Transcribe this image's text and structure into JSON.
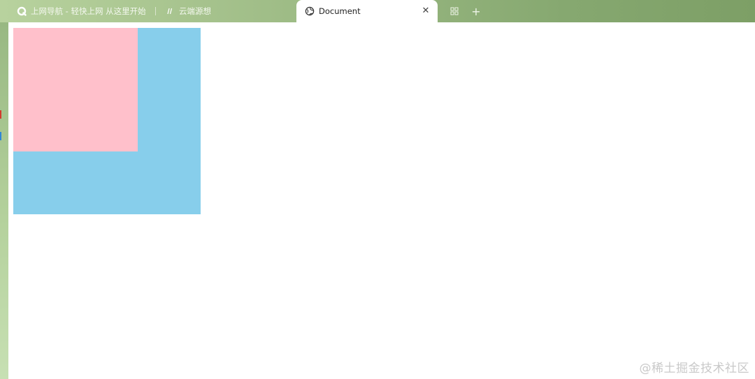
{
  "tabs": [
    {
      "title": "上网导航 - 轻快上网 从这里开始",
      "icon": "browser-q-icon"
    },
    {
      "title": "云端源想",
      "icon": "site-icon"
    },
    {
      "title": "Document",
      "icon": "globe-icon",
      "active": true
    }
  ],
  "tabbar": {
    "close_glyph": "✕",
    "plus_glyph": "+"
  },
  "page": {
    "outer_box_color": "#87ceeb",
    "inner_box_color": "#ffc0cb"
  },
  "watermark": "@稀土掘金技术社区"
}
